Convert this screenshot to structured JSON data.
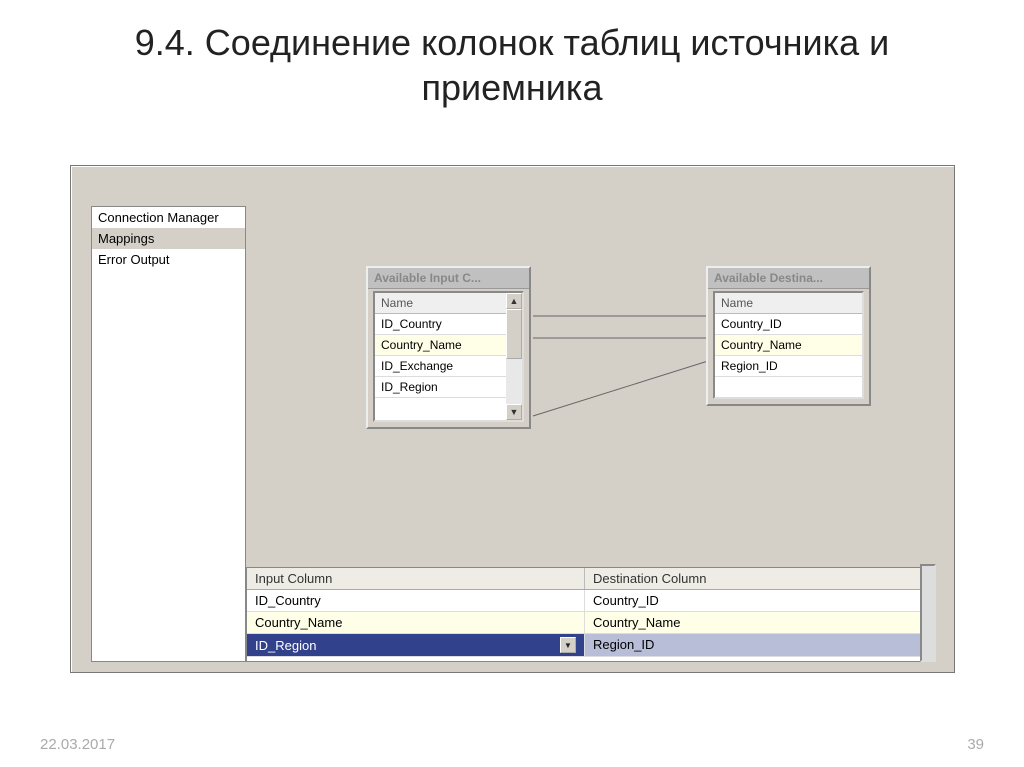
{
  "slide": {
    "title": "9.4. Соединение колонок таблиц источника и приемника",
    "date": "22.03.2017",
    "page": "39"
  },
  "sidebar": {
    "items": [
      {
        "label": "Connection Manager",
        "selected": false
      },
      {
        "label": "Mappings",
        "selected": true
      },
      {
        "label": "Error Output",
        "selected": false
      }
    ]
  },
  "input_box": {
    "title": "Available Input C...",
    "header": "Name",
    "rows": [
      "ID_Country",
      "Country_Name",
      "ID_Exchange",
      "ID_Region"
    ]
  },
  "dest_box": {
    "title": "Available Destina...",
    "header": "Name",
    "rows": [
      "Country_ID",
      "Country_Name",
      "Region_ID"
    ]
  },
  "map_table": {
    "headers": {
      "input": "Input Column",
      "dest": "Destination Column"
    },
    "rows": [
      {
        "input": "ID_Country",
        "dest": "Country_ID",
        "state": "normal"
      },
      {
        "input": "Country_Name",
        "dest": "Country_Name",
        "state": "hl"
      },
      {
        "input": "ID_Region",
        "dest": "Region_ID",
        "state": "sel"
      }
    ]
  },
  "glyphs": {
    "up": "▲",
    "down": "▼"
  }
}
